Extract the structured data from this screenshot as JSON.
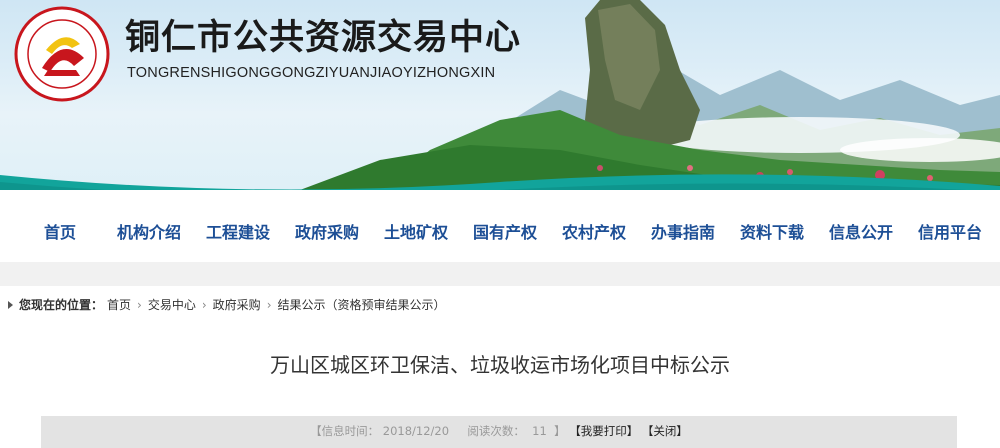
{
  "header": {
    "title": "铜仁市公共资源交易中心",
    "subtitle": "TONGRENSHIGONGGONGZIYUANJIAOYIZHONGXIN",
    "logo_icon": "tongren-seal-logo"
  },
  "nav": {
    "items": [
      "首页",
      "机构介绍",
      "工程建设",
      "政府采购",
      "土地矿权",
      "国有产权",
      "农村产权",
      "办事指南",
      "资料下载",
      "信息公开",
      "信用平台"
    ]
  },
  "breadcrumb": {
    "label": "您现在的位置：",
    "items": [
      "首页",
      "交易中心",
      "政府采购",
      "结果公示（资格预审结果公示）"
    ]
  },
  "article": {
    "title": "万山区城区环卫保洁、垃圾收运市场化项目中标公示",
    "info": {
      "date_label": "【信息时间：",
      "date_value": "2018/12/20",
      "views_label": "阅读次数：",
      "views_value": "11",
      "views_close": "】",
      "print_label": "【我要打印】",
      "close_label": "【关闭】"
    }
  },
  "colors": {
    "nav_text": "#1d4f96",
    "logo_red": "#c8161d",
    "logo_yellow": "#f2c311"
  }
}
